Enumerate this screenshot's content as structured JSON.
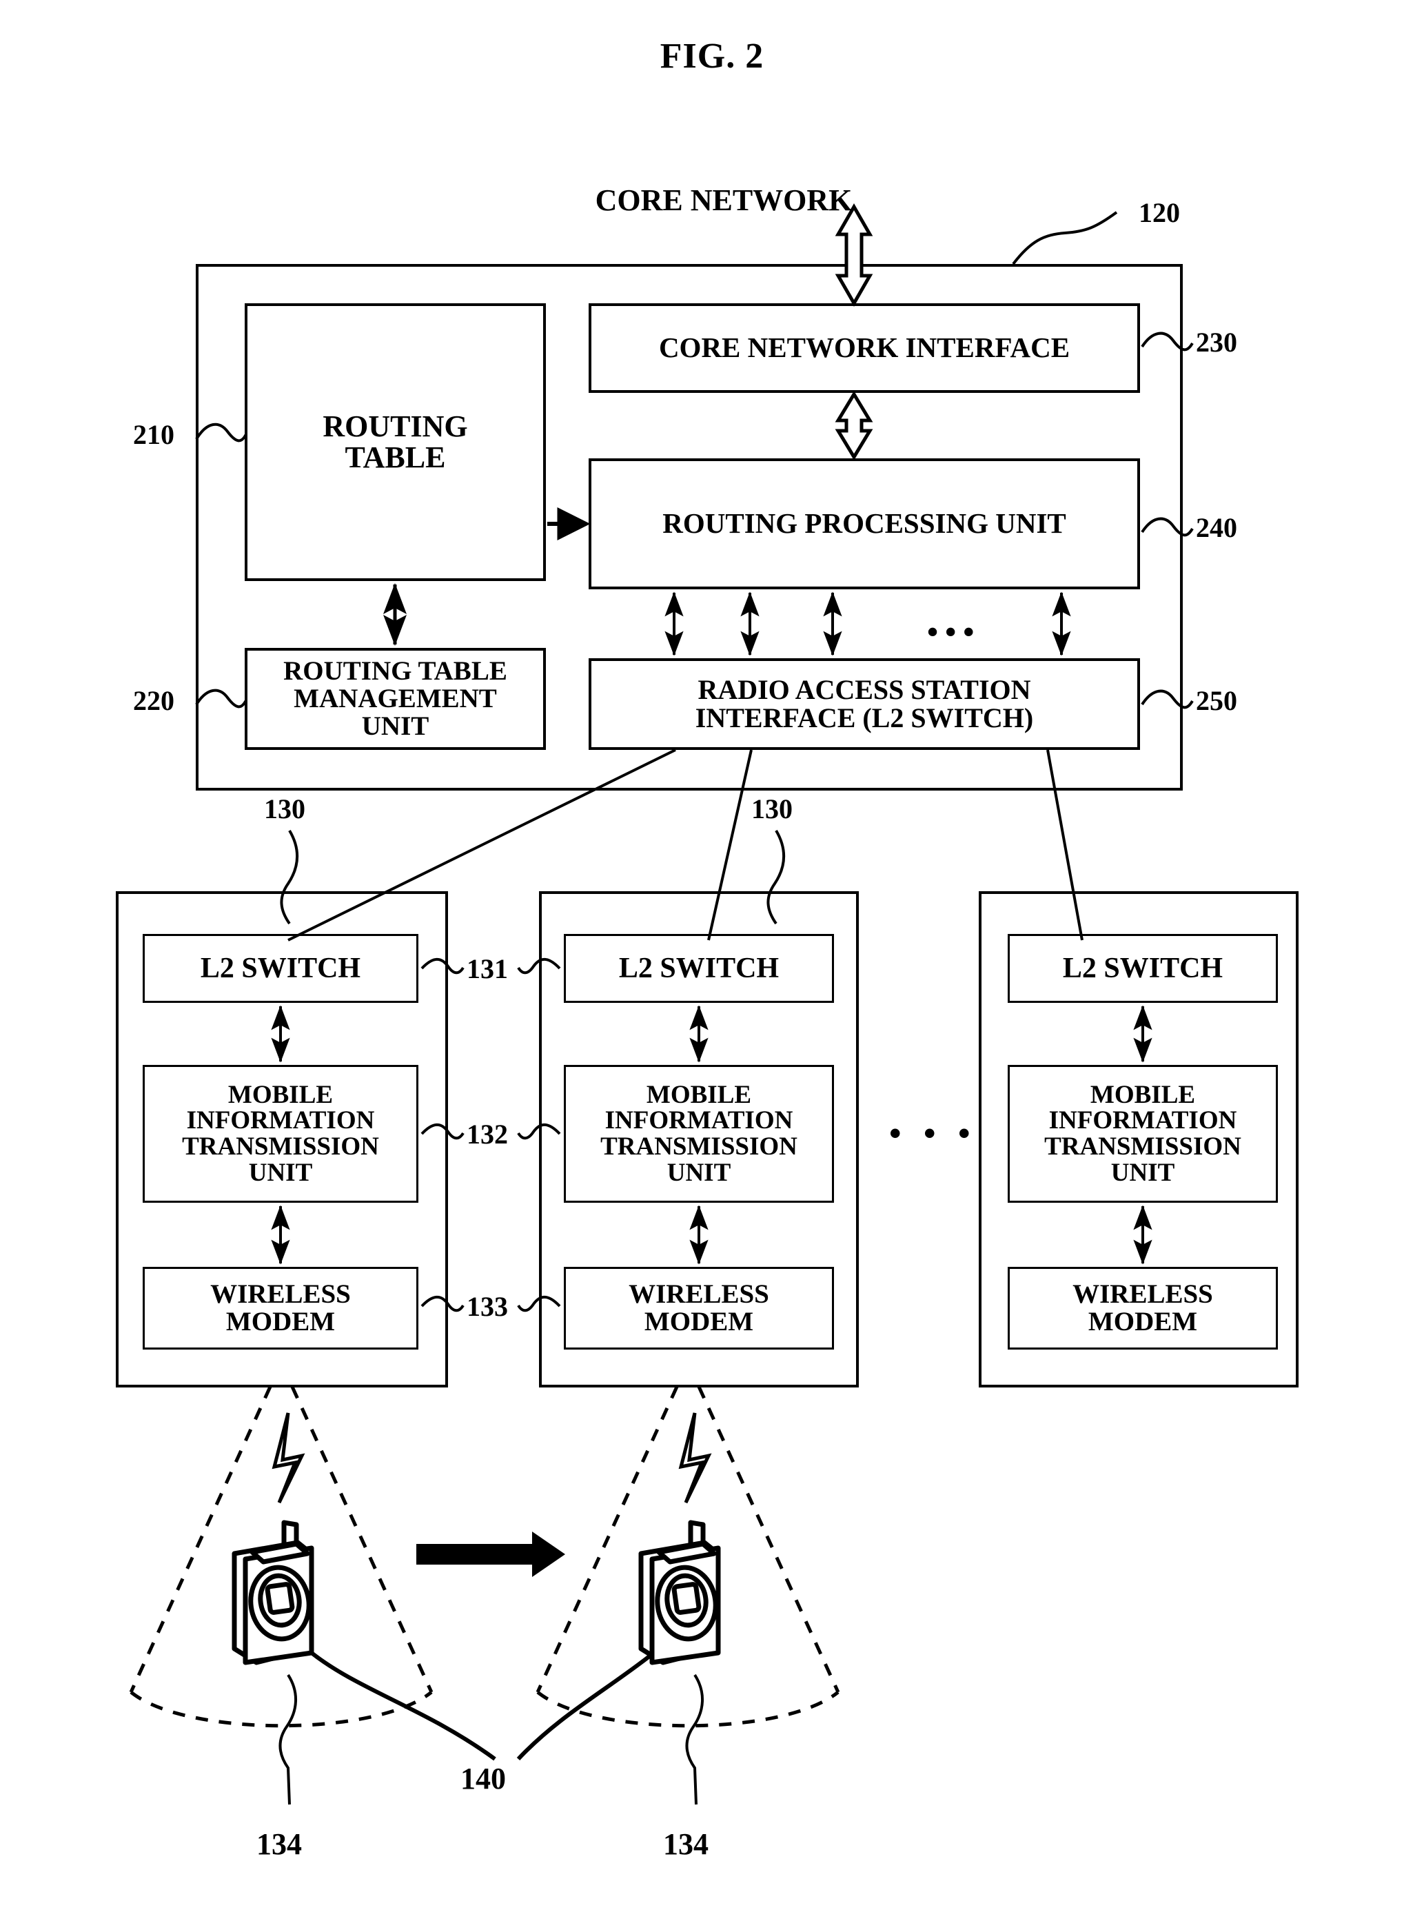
{
  "figure": {
    "title": "FIG. 2",
    "core_network_label": "CORE NETWORK"
  },
  "router": {
    "ref": "120",
    "blocks": {
      "routing_table": {
        "label": "ROUTING\nTABLE",
        "line1": "ROUTING",
        "line2": "TABLE",
        "ref": "210"
      },
      "routing_table_mgmt": {
        "line1": "ROUTING TABLE",
        "line2": "MANAGEMENT",
        "line3": "UNIT",
        "ref": "220"
      },
      "core_network_interface": {
        "label": "CORE NETWORK INTERFACE",
        "ref": "230"
      },
      "routing_processing_unit": {
        "label": "ROUTING PROCESSING UNIT",
        "ref": "240"
      },
      "radio_access_station_interface": {
        "line1": "RADIO ACCESS STATION",
        "line2": "INTERFACE (L2 SWITCH)",
        "ref": "250"
      }
    },
    "bus_ellipsis": "•••"
  },
  "base_stations": {
    "ref": "130",
    "ellipsis": "• • •",
    "component_refs": {
      "l2_switch": "131",
      "mobile_info_unit": "132",
      "wireless_modem": "133"
    },
    "items": [
      {
        "l2_switch": "L2 SWITCH",
        "mobile_info_unit": {
          "line1": "MOBILE",
          "line2": "INFORMATION",
          "line3": "TRANSMISSION",
          "line4": "UNIT"
        },
        "wireless_modem": {
          "line1": "WIRELESS",
          "line2": "MODEM"
        }
      },
      {
        "l2_switch": "L2 SWITCH",
        "mobile_info_unit": {
          "line1": "MOBILE",
          "line2": "INFORMATION",
          "line3": "TRANSMISSION",
          "line4": "UNIT"
        },
        "wireless_modem": {
          "line1": "WIRELESS",
          "line2": "MODEM"
        }
      },
      {
        "l2_switch": "L2 SWITCH",
        "mobile_info_unit": {
          "line1": "MOBILE",
          "line2": "INFORMATION",
          "line3": "TRANSMISSION",
          "line4": "UNIT"
        },
        "wireless_modem": {
          "line1": "WIRELESS",
          "line2": "MODEM"
        }
      }
    ]
  },
  "cells": {
    "left_ref": "134",
    "right_ref": "134"
  },
  "mobile_terminal": {
    "ref": "140"
  },
  "colors": {
    "ink": "#000000",
    "paper": "#ffffff"
  }
}
